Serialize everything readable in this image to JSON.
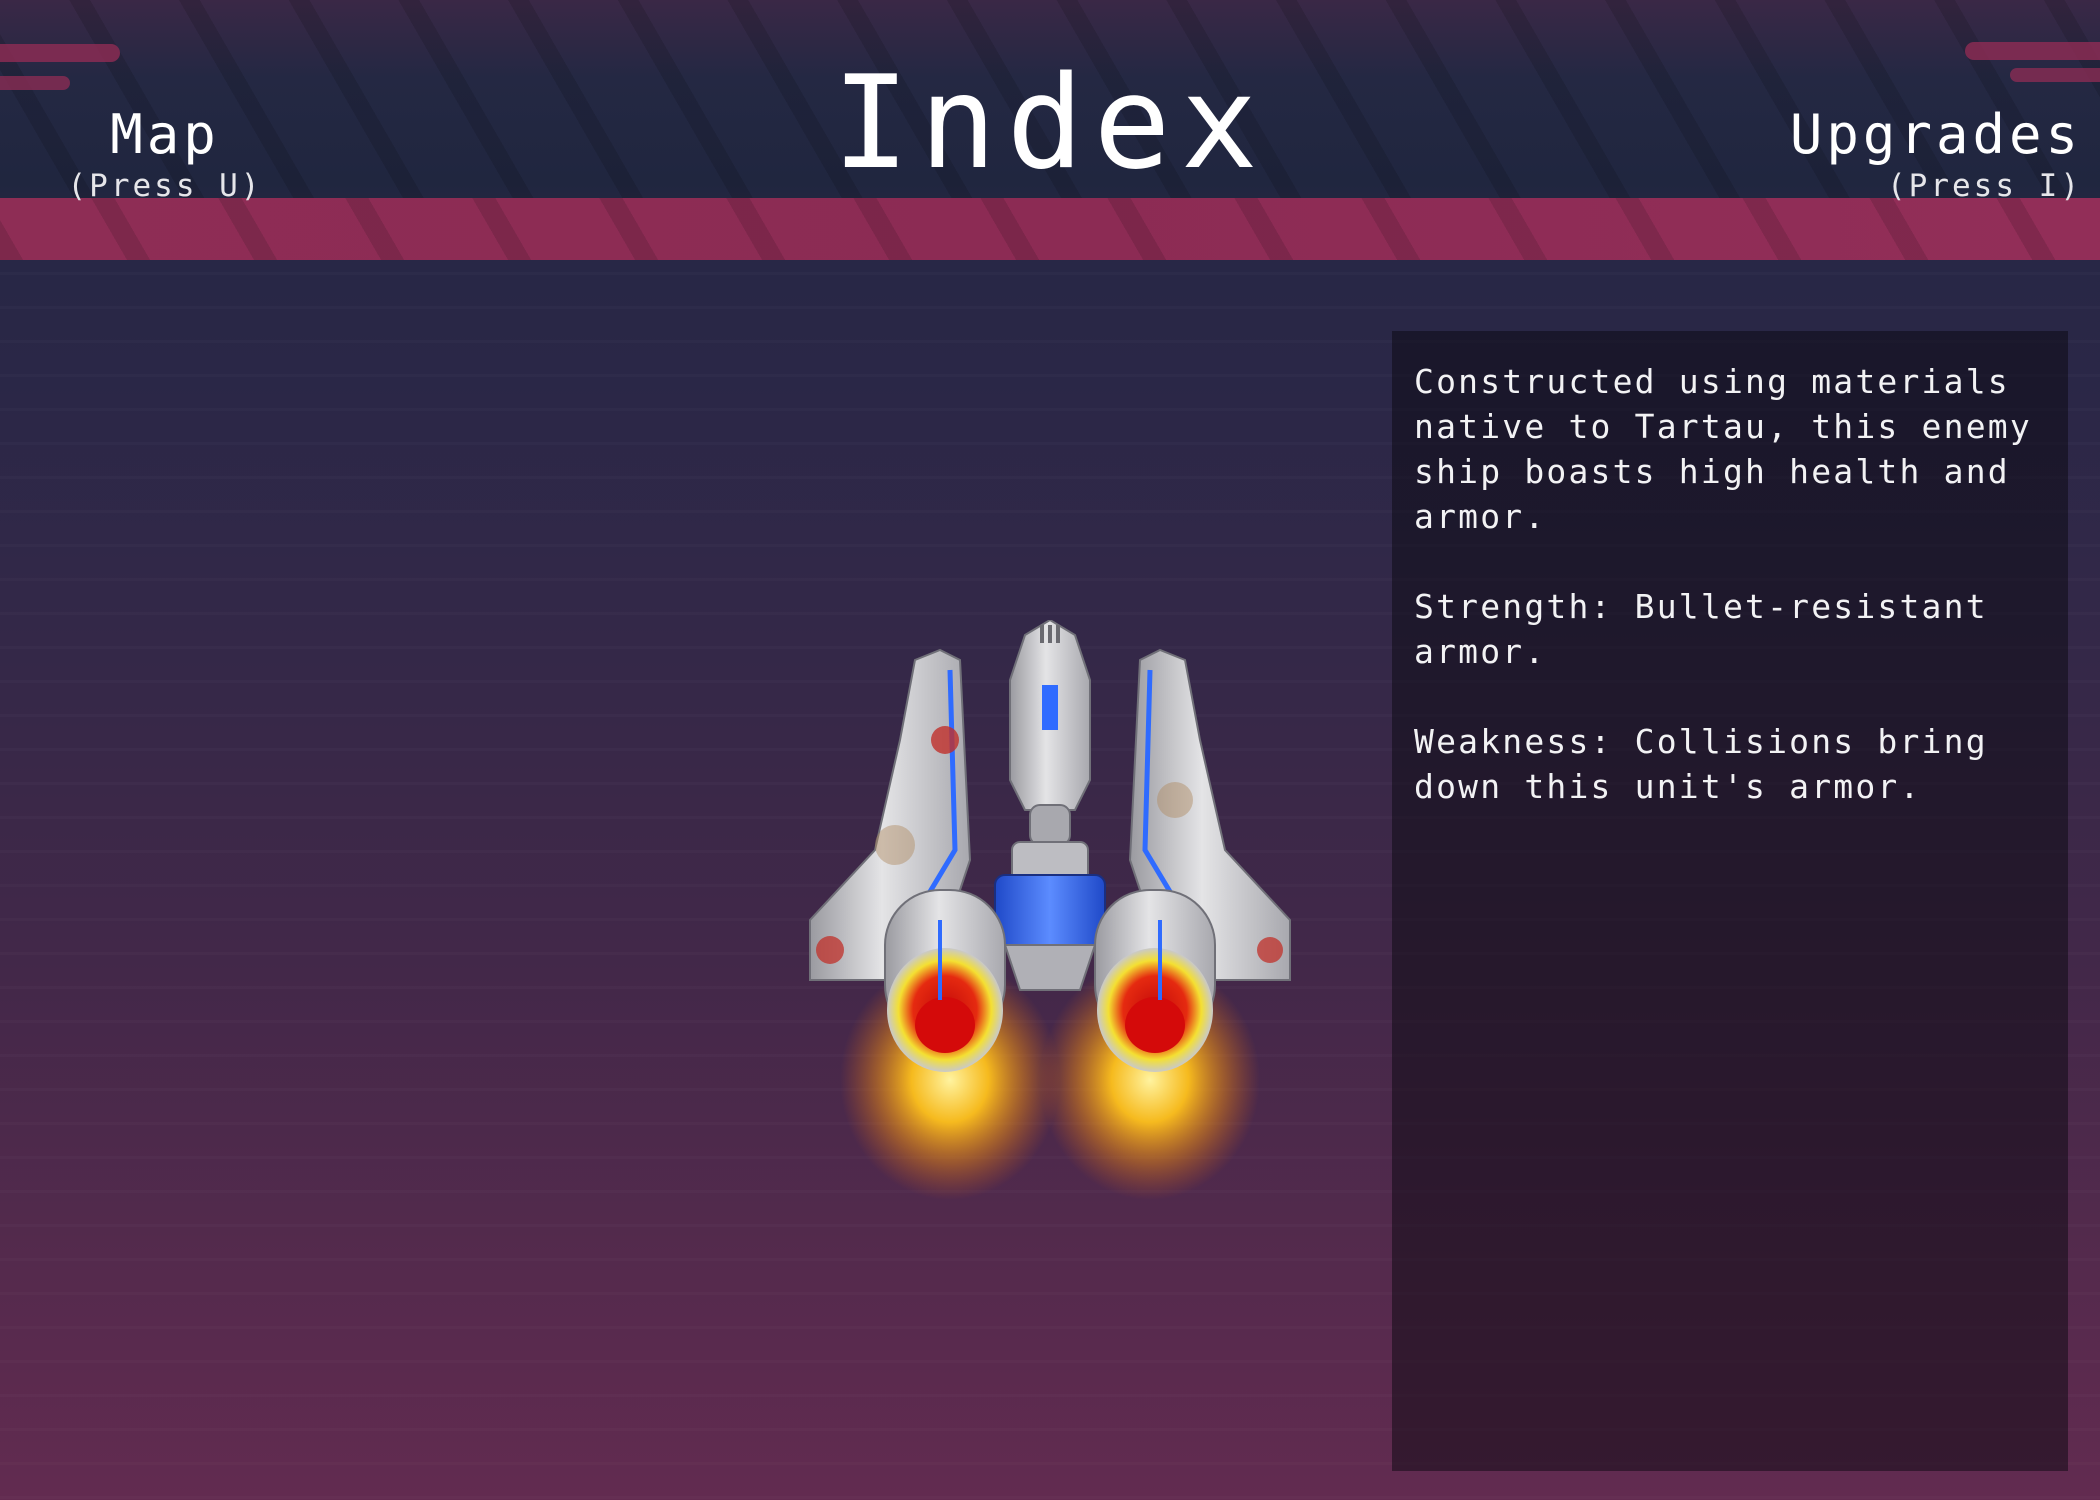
{
  "header": {
    "title": "Index",
    "left_nav": {
      "label": "Map",
      "hint": "(Press U)"
    },
    "right_nav": {
      "label": "Upgrades",
      "hint": "(Press I)"
    }
  },
  "entry": {
    "ship_icon": "enemy-ship-icon",
    "description": "Constructed using materials native to Tartau, this enemy ship boasts high health and armor.",
    "strength": "Strength: Bullet-resistant armor.",
    "weakness": "Weakness: Collisions bring down this unit's armor."
  },
  "colors": {
    "header_band": "#8e2d55",
    "panel_bg": "#161320",
    "engine_glow": "#ffb21a",
    "ship_accent": "#2f6bff"
  }
}
